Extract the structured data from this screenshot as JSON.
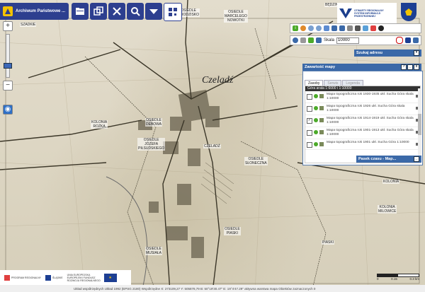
{
  "app": {
    "title": "Archiwum Państwowe ..."
  },
  "toolbar": {
    "icons": [
      "folder-icon",
      "window-icon",
      "tools-icon",
      "search-icon",
      "layers-icon",
      "qr-icon"
    ]
  },
  "map": {
    "town": "Czeladź",
    "labels": [
      {
        "text": "OSIEDLE\nGRODZISKO"
      },
      {
        "text": "OSIEDLE\nMARCELEGO\nNOWOTKI"
      },
      {
        "text": "KOLONIA\nROŻKA"
      },
      {
        "text": "OSIEDLE\nJÓZEFA\nPIŁSUDSKIEGO"
      },
      {
        "text": "CZELADŹ"
      },
      {
        "text": "OSIEDLE\nSŁONECZNA"
      },
      {
        "text": "OSIEDLE\nMUSIAŁA"
      },
      {
        "text": "OSIEDLE\nPIASKI"
      },
      {
        "text": "OSIEDLE\nDEBOWA"
      },
      {
        "text": "KOLONIA\nMILOWICE"
      },
      {
        "text": "KOLONIA"
      },
      {
        "text": "SZADKIE"
      },
      {
        "text": "BĘDZIN"
      },
      {
        "text": "PIASKI"
      }
    ]
  },
  "branding": {
    "system_text": "OTWARTY REGIONALNY\nSYSTEM INFORMACJI\nPRZESTRZENNEJ"
  },
  "scale": {
    "label": "Skala",
    "value": "10000"
  },
  "search_panel": {
    "title": "Szukaj adresu"
  },
  "content_panel": {
    "title": "Zawartość mapy",
    "tabs": [
      "Zasoby",
      "Serwis",
      "Legenda"
    ],
    "header_item": "Góra arata 1:6000 i 1:10000",
    "layers": [
      {
        "name": "Mapa topograficzna rok 1930-1935 ukł. Sucha Góra skala 1:10000",
        "checked": false
      },
      {
        "name": "Mapa topograficzna rok 1926 ukł. Sucha Góra skala 1:10000",
        "checked": false
      },
      {
        "name": "Mapa topograficzna rok 1914-1919 ukł. Sucha Góra skala 1:10000",
        "checked": true
      },
      {
        "name": "Mapa topograficzna rok 1901-1913 ukł. Sucha Góra skala 1:10000",
        "checked": false
      },
      {
        "name": "Mapa topograficzna rok 1901 ukł. Sucha Góra 1:10000",
        "checked": false
      }
    ]
  },
  "time_panel": {
    "title": "Pasek czasu - Map..."
  },
  "footer": {
    "logos": [
      "PROGRAM REGIONALNY",
      "ŚLĄSKIE",
      "UNIA EUROPEJSKA EUROPEJSKI FUNDUSZ ROZWOJU REGIONALNEGO"
    ],
    "status": "Układ współrzędnych Układ 1992 (EPSG 2180)   Współrzędne X: 273109,27 Y: 505878,79   B: 50°19'30.47\" E: 19°4'47.29\"   aktywna warstwa mapa   Obiektów zaznaczonych 0"
  },
  "scalebar": {
    "left": "0",
    "mid": "0.15",
    "right": "0.3 km"
  }
}
